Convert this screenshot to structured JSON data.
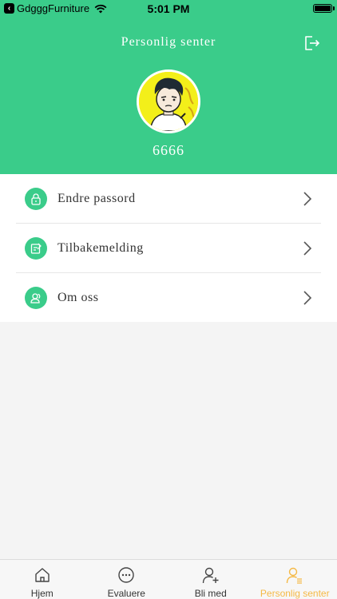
{
  "status_bar": {
    "carrier": "GdgggFurniture",
    "time": "5:01 PM"
  },
  "header": {
    "title": "Personlig senter",
    "username": "6666",
    "logout_icon": "logout-icon",
    "avatar_icon": "cartoon-avatar",
    "background_color": "#3acc8a"
  },
  "menu": {
    "items": [
      {
        "label": "Endre passord",
        "icon": "lock-icon"
      },
      {
        "label": "Tilbakemelding",
        "icon": "feedback-icon"
      },
      {
        "label": "Om oss",
        "icon": "people-icon"
      }
    ]
  },
  "tabbar": {
    "active_color": "#f5b945",
    "tabs": [
      {
        "label": "Hjem",
        "icon": "home-icon",
        "active": false
      },
      {
        "label": "Evaluere",
        "icon": "chat-icon",
        "active": false
      },
      {
        "label": "Bli med",
        "icon": "add-user-icon",
        "active": false
      },
      {
        "label": "Personlig senter",
        "icon": "profile-icon",
        "active": true
      }
    ]
  }
}
